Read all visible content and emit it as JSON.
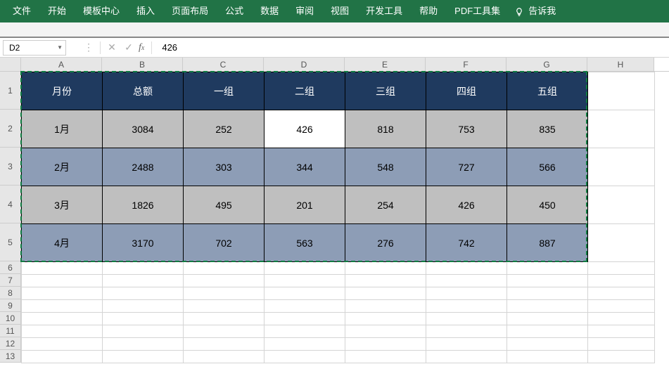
{
  "menu": {
    "items": [
      "文件",
      "开始",
      "模板中心",
      "插入",
      "页面布局",
      "公式",
      "数据",
      "审阅",
      "视图",
      "开发工具",
      "帮助",
      "PDF工具集"
    ],
    "tell_me": "告诉我"
  },
  "namebox": {
    "value": "D2"
  },
  "formula": {
    "value": "426"
  },
  "columns": [
    "A",
    "B",
    "C",
    "D",
    "E",
    "F",
    "G",
    "H"
  ],
  "row_nums_tall": [
    "1",
    "2",
    "3",
    "4",
    "5"
  ],
  "row_nums_short": [
    "6",
    "7",
    "8",
    "9",
    "10",
    "11",
    "12",
    "13"
  ],
  "table": {
    "headers": [
      "月份",
      "总额",
      "一组",
      "二组",
      "三组",
      "四组",
      "五组"
    ],
    "rows": [
      [
        "1月",
        "3084",
        "252",
        "426",
        "818",
        "753",
        "835"
      ],
      [
        "2月",
        "2488",
        "303",
        "344",
        "548",
        "727",
        "566"
      ],
      [
        "3月",
        "1826",
        "495",
        "201",
        "254",
        "426",
        "450"
      ],
      [
        "4月",
        "3170",
        "702",
        "563",
        "276",
        "742",
        "887"
      ]
    ]
  },
  "active_cell": {
    "row": 0,
    "col": 3
  },
  "chart_data": {
    "type": "table",
    "title": "",
    "columns": [
      "月份",
      "总额",
      "一组",
      "二组",
      "三组",
      "四组",
      "五组"
    ],
    "rows": [
      {
        "月份": "1月",
        "总额": 3084,
        "一组": 252,
        "二组": 426,
        "三组": 818,
        "四组": 753,
        "五组": 835
      },
      {
        "月份": "2月",
        "总额": 2488,
        "一组": 303,
        "二组": 344,
        "三组": 548,
        "四组": 727,
        "五组": 566
      },
      {
        "月份": "3月",
        "总额": 1826,
        "一组": 495,
        "二组": 201,
        "三组": 254,
        "四组": 426,
        "五组": 450
      },
      {
        "月份": "4月",
        "总额": 3170,
        "一组": 702,
        "二组": 563,
        "三组": 276,
        "四组": 742,
        "五组": 887
      }
    ]
  }
}
